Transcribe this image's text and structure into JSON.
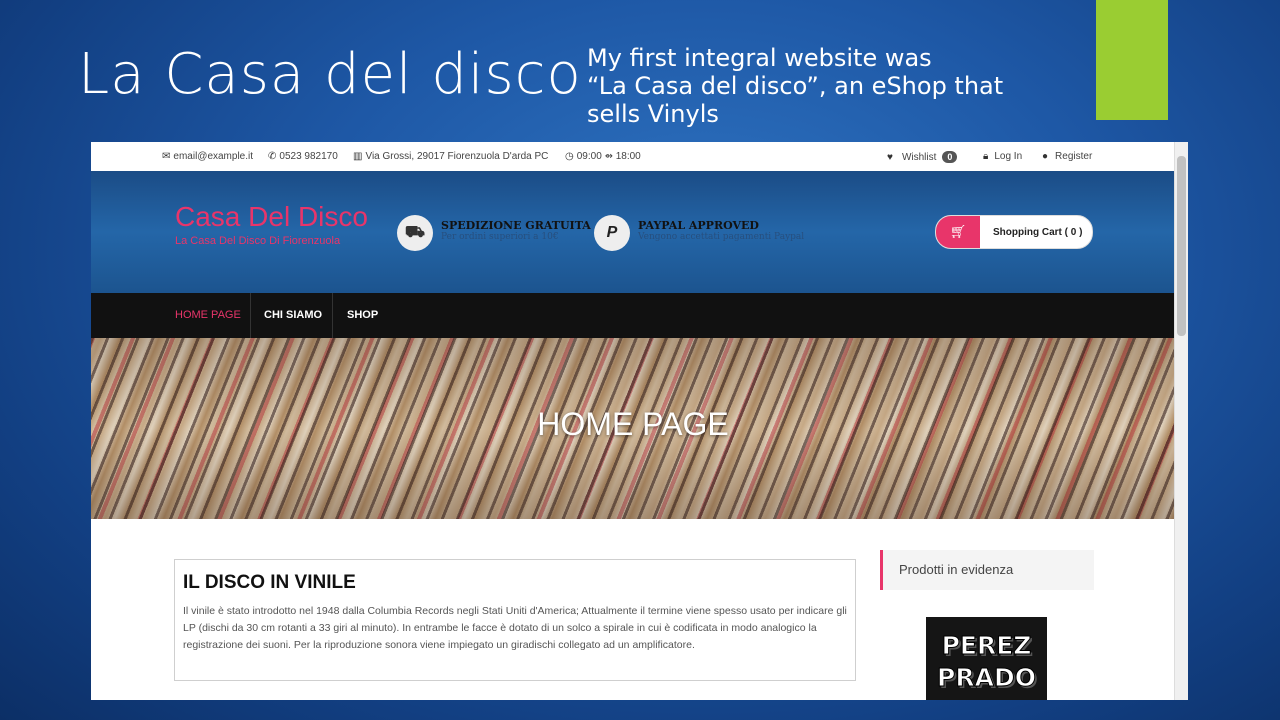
{
  "slide": {
    "title": "La Casa del disco",
    "caption": "My first integral website was\n“La Casa del disco”, an eShop that\nsells Vinyls",
    "accent_color": "#9acd32"
  },
  "topbar": {
    "email": "email@example.it",
    "phone": "0523 982170",
    "address": "Via Grossi, 29017 Fiorenzuola D'arda PC",
    "hours": "09:00 ⇴ 18:00",
    "wishlist_label": "Wishlist",
    "wishlist_count": "0",
    "login_label": "Log In",
    "register_label": "Register"
  },
  "header": {
    "brand": "Casa Del Disco",
    "brand_sub": "La Casa Del Disco Di Fiorenzuola",
    "brand_color": "#e8356a",
    "feature1_title": "SPEDIZIONE GRATUITA",
    "feature1_text": "Per ordini superiori a 10€",
    "feature1_icon": "truck-icon",
    "feature2_title": "PAYPAL APPROVED",
    "feature2_text": "Vengono accettati pagamenti Paypal",
    "feature2_icon": "paypal-icon",
    "cart_label": "Shopping Cart ( 0 )"
  },
  "nav": {
    "items": [
      {
        "label": "HOME PAGE",
        "active": true
      },
      {
        "label": "CHI SIAMO",
        "active": false
      },
      {
        "label": "SHOP",
        "active": false
      }
    ]
  },
  "hero": {
    "title": "HOME PAGE"
  },
  "article": {
    "title": "IL DISCO IN VINILE",
    "body": "Il vinile è stato introdotto nel 1948 dalla Columbia Records negli Stati Uniti d'America; Attualmente il termine viene spesso usato per indicare gli LP (dischi da 30 cm rotanti a 33 giri al minuto). In entrambe le facce è dotato di un solco a spirale in cui è codificata in modo analogico la registrazione dei suoni. Per la riproduzione sonora viene impiegato un giradischi collegato ad un amplificatore."
  },
  "sidebar": {
    "title": "Prodotti in evidenza",
    "product_line1": "PEREZ",
    "product_line2": "PRADO"
  }
}
